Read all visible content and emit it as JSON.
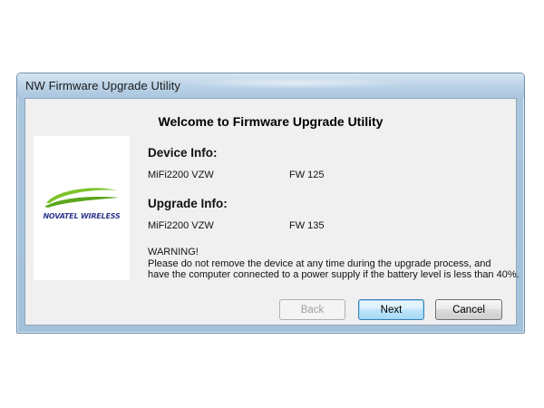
{
  "window": {
    "title": "NW Firmware Upgrade Utility"
  },
  "dialog": {
    "heading": "Welcome to Firmware Upgrade Utility",
    "logo": {
      "text": "NOVATEL WIRELESS",
      "icon": "novatel-swoosh-logo"
    },
    "device_info": {
      "title": "Device Info:",
      "model": "MiFi2200 VZW",
      "firmware": "FW 125"
    },
    "upgrade_info": {
      "title": "Upgrade Info:",
      "model": "MiFi2200 VZW",
      "firmware": "FW 135"
    },
    "warning": {
      "title": "WARNING!",
      "line1": "Please do not remove the device at any time during the upgrade process, and",
      "line2": "have the computer connected to a power supply if the battery level is less than 40%."
    },
    "buttons": {
      "back": "Back",
      "next": "Next",
      "cancel": "Cancel"
    }
  },
  "colors": {
    "logo_green": "#7dc32a",
    "logo_blue": "#2f3a8f",
    "default_button_border": "#3c7fb1"
  }
}
